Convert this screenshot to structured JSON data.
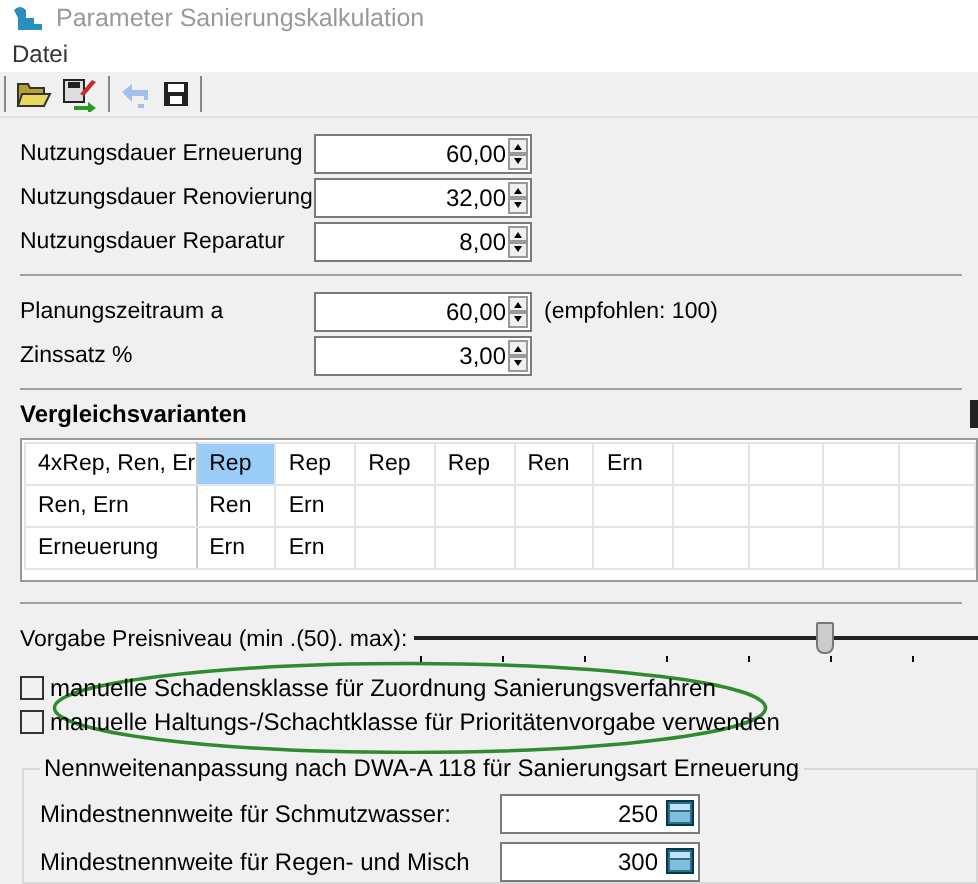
{
  "window": {
    "title": "Parameter Sanierungskalkulation"
  },
  "menu": [
    "Datei"
  ],
  "toolbar": [
    {
      "kind": "open"
    },
    {
      "kind": "export"
    },
    {
      "kind": "undo",
      "disabled": true
    },
    {
      "kind": "save"
    }
  ],
  "fields": [
    {
      "label": "Nutzungsdauer Erneuerung",
      "value": "60,00"
    },
    {
      "label": "Nutzungsdauer Renovierung",
      "value": "32,00"
    },
    {
      "label": "Nutzungsdauer Reparatur",
      "value": "8,00"
    }
  ],
  "fields_2": [
    {
      "label": "Planungszeitraum a",
      "value": "60,00",
      "hint": "(empfohlen: 100)"
    },
    {
      "label": "Zinssatz %",
      "value": "3,00"
    }
  ],
  "variants": {
    "title": "Vergleichsvarianten",
    "rows": [
      {
        "name": "4xRep, Ren, Er",
        "cells": [
          {
            "text": "Rep",
            "selected": true
          },
          {
            "text": "Rep",
            "selected": false
          },
          {
            "text": "Rep",
            "selected": false
          },
          {
            "text": "Rep",
            "selected": false
          },
          {
            "text": "Ren",
            "selected": false
          },
          {
            "text": "Ern",
            "selected": false
          }
        ]
      },
      {
        "name": "Ren, Ern",
        "cells": [
          {
            "text": "Ren",
            "selected": false
          },
          {
            "text": "Ern",
            "selected": false
          }
        ]
      },
      {
        "name": "Erneuerung",
        "cells": [
          {
            "text": "Ern",
            "selected": false
          },
          {
            "text": "Ern",
            "selected": false
          }
        ]
      }
    ]
  },
  "price_level": {
    "label": "Vorgabe Preisniveau (min .(50). max):",
    "level": 0.73
  },
  "checkboxes": [
    {
      "label": "manuelle Schadensklasse für Zuordnung Sanierungsverfahren",
      "checked": false
    },
    {
      "label": "manuelle Haltungs-/Schachtklasse für Prioritätenvorgabe verwenden",
      "checked": false
    }
  ],
  "nominal_group": {
    "title": "Nennweitenanpassung nach DWA-A 118 für Sanierungsart Erneuerung",
    "rows": [
      {
        "label": "Mindestnennweite für Schmutzwasser:",
        "value": "250"
      },
      {
        "label": "Mindestnennweite für Regen- und Misch",
        "value": "300"
      }
    ]
  }
}
